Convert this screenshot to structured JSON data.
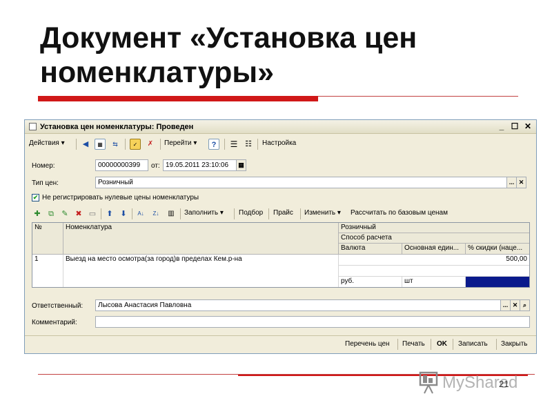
{
  "slide": {
    "title_line1": "Документ «Установка цен",
    "title_line2": "номенклатуры»",
    "watermark": "MyShared",
    "page_number": "21"
  },
  "window": {
    "title": "Установка цен номенклатуры: Проведен",
    "controls": {
      "minimize": "_",
      "maximize": "☐",
      "close": "✕"
    }
  },
  "toolbar": {
    "actions": "Действия",
    "goto": "Перейти",
    "help": "?",
    "settings": "Настройка"
  },
  "form": {
    "number_label": "Номер:",
    "number_value": "00000000399",
    "date_label": "от:",
    "date_value": "19.05.2011 23:10:06",
    "price_type_label": "Тип цен:",
    "price_type_value": "Розничный",
    "zero_prices_checkbox": "Не регистрировать нулевые цены номенклатуры",
    "responsible_label": "Ответственный:",
    "responsible_value": "Лысова Анастасия Павловна",
    "comment_label": "Комментарий:",
    "comment_value": ""
  },
  "table_toolbar": {
    "fill": "Заполнить",
    "selection": "Подбор",
    "price_list": "Прайс",
    "change": "Изменить",
    "calc_base": "Рассчитать по базовым ценам"
  },
  "table": {
    "headers": {
      "num": "№",
      "item": "Номенклатура",
      "price_type": "Розничный",
      "calc_method": "Способ расчета",
      "currency": "Валюта",
      "unit": "Основная един...",
      "discount": "% скидки (наце..."
    },
    "rows": [
      {
        "num": "1",
        "item": "Выезд на место осмотра(за город)в пределах Кем.р-на",
        "price": "500,00",
        "currency": "руб.",
        "unit": "шт"
      }
    ]
  },
  "footer": {
    "price_list_btn": "Перечень цен",
    "print_btn": "Печать",
    "ok_btn": "OK",
    "save_btn": "Записать",
    "close_btn": "Закрыть"
  },
  "colors": {
    "accent_red": "#d01818",
    "selected_cell": "#0a1a8c"
  }
}
